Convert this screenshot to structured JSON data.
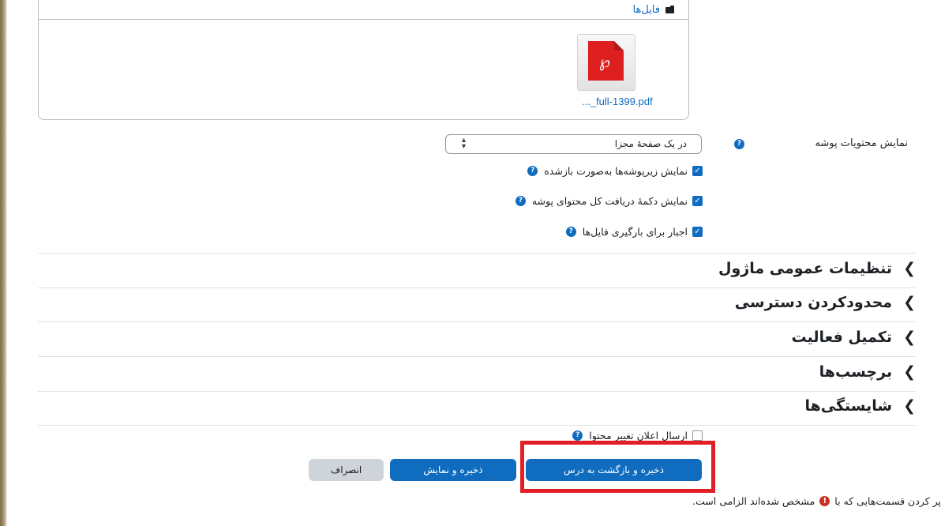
{
  "file_manager": {
    "folder_label": "فایل‌ها",
    "file_name": "..._full-1399.pdf"
  },
  "display_contents": {
    "label": "نمایش محتویات پوشه",
    "selected": "در یک صفحهٔ مجزا"
  },
  "options": {
    "show_subfolders_expanded": "نمایش زیرپوشه‌ها به‌صورت بازشده",
    "show_download_button": "نمایش دکمهٔ دریافت کل محتوای پوشه",
    "force_download": "اجبار برای بارگیری فایل‌ها"
  },
  "sections": [
    "تنظیمات عمومی ماژول",
    "محدودکردن دسترسی",
    "تکمیل فعالیت",
    "برچسب‌ها",
    "شایستگی‌ها"
  ],
  "send_notification": "ارسال اعلان تغییر محتوا",
  "buttons": {
    "save_return": "ذخیره و بازگشت به درس",
    "save_display": "ذخیره و نمایش",
    "cancel": "انصراف"
  },
  "required_note": {
    "before": "پر کردن قسمت‌هایی که با",
    "after": "مشخص شده‌اند الزامی است."
  },
  "icons": {
    "help": "question-circle",
    "required": "exclamation-circle",
    "folder": "folder",
    "pdf": "pdf-file"
  },
  "colors": {
    "primary": "#0f6cbf",
    "secondary": "#ced4da",
    "highlight": "#e31f26",
    "required": "#ca3120"
  },
  "checkbox_states": {
    "show_subfolders_expanded": true,
    "show_download_button": true,
    "force_download": true,
    "send_notification": false
  }
}
